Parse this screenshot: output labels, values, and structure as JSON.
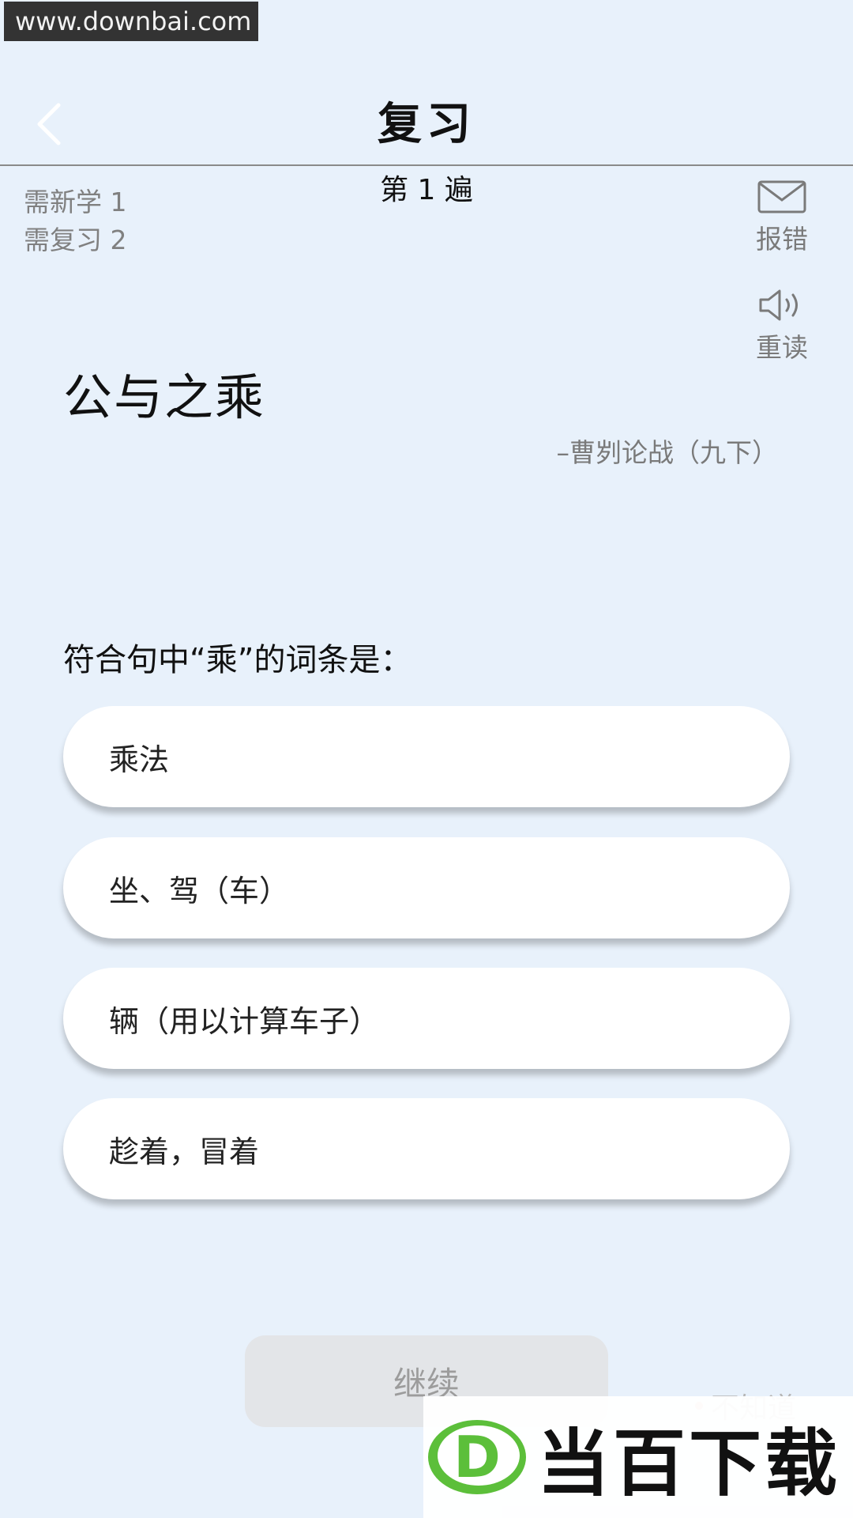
{
  "watermark": {
    "top_url": "www.downbai.com",
    "bottom_text": "当百下载",
    "logo_letter": "D"
  },
  "header": {
    "title": "复习",
    "back_icon": "chevron-left-icon"
  },
  "stats": {
    "new_to_learn": "需新学 1",
    "to_review": "需复习 2"
  },
  "pass_label": "第 1 遍",
  "tools": {
    "report": {
      "icon": "envelope-icon",
      "label": "报错"
    },
    "reread": {
      "icon": "speaker-icon",
      "label": "重读"
    }
  },
  "word": "公与之乘",
  "source": "–曹刿论战（九下）",
  "question": "符合句中“乘”的词条是：",
  "options": [
    "乘法",
    "坐、驾（车）",
    "辆（用以计算车子）",
    "趁着，冒着"
  ],
  "actions": {
    "continue": "继续",
    "dont_know": "不知道"
  },
  "colors": {
    "background": "#e8f1fb",
    "option_bg": "#ffffff",
    "button_disabled": "#e3e5e8",
    "logo_green": "#5cbf3a"
  }
}
